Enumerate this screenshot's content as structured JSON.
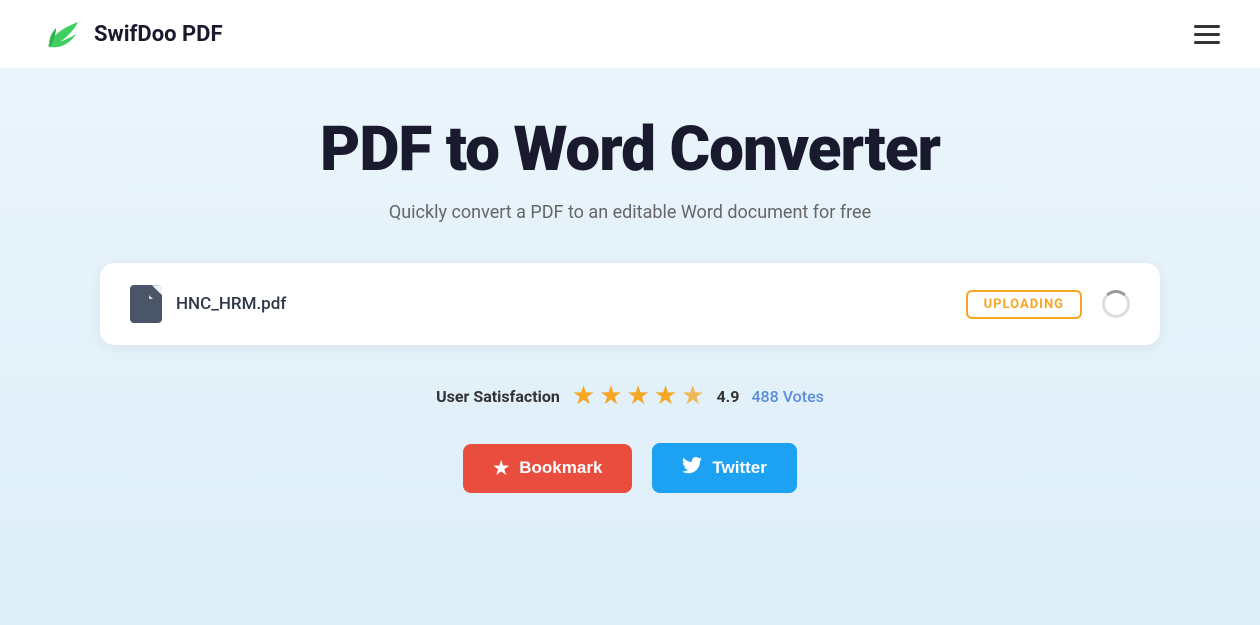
{
  "brand": {
    "name": "SwifDoo PDF",
    "logo_alt": "SwifDoo PDF Logo"
  },
  "navbar": {
    "menu_label": "Menu"
  },
  "hero": {
    "title": "PDF to Word Converter",
    "subtitle": "Quickly convert a PDF to an editable Word document for free"
  },
  "upload": {
    "file_name": "HNC_HRM.pdf",
    "status_badge": "UPLOADING",
    "spinner_label": "Loading"
  },
  "rating": {
    "label": "User Satisfaction",
    "score": "4.9",
    "votes": "488 Votes",
    "stars": [
      {
        "type": "full"
      },
      {
        "type": "full"
      },
      {
        "type": "full"
      },
      {
        "type": "full"
      },
      {
        "type": "half"
      }
    ]
  },
  "buttons": {
    "bookmark_label": "Bookmark",
    "twitter_label": "Twitter"
  }
}
